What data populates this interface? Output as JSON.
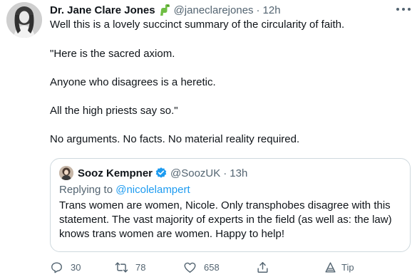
{
  "tweet": {
    "author": {
      "name": "Dr. Jane Clare Jones",
      "emoji_icon": "dinosaur-emoji",
      "handle": "@janeclarejones",
      "separator": "·",
      "time": "12h"
    },
    "lines": [
      "Well this is a lovely succinct summary of the circularity of faith.",
      "\"Here is the sacred axiom.",
      "Anyone who disagrees is a heretic.",
      "All the high priests say so.\"",
      "No arguments. No facts. No material reality required."
    ],
    "quote": {
      "name": "Sooz Kempner",
      "verified_icon": "verified-badge-icon",
      "handle": "@SoozUK",
      "separator": "·",
      "time": "13h",
      "replying_prefix": "Replying to",
      "replying_to": "@nicolelampert",
      "body_lines": [
        "Trans women are women, Nicole. Only transphobes disagree with this",
        "statement. The vast majority of experts in the field (as well as: the law)",
        "knows trans women are women. Happy to help!"
      ]
    },
    "actions": {
      "reply_count": "30",
      "retweet_count": "78",
      "like_count": "658",
      "tip_label": "Tip"
    },
    "colors": {
      "text": "#0f1419",
      "muted": "#536471",
      "link": "#1d9bf0",
      "border": "#cfd9de",
      "dino": "#6fbe44"
    }
  }
}
